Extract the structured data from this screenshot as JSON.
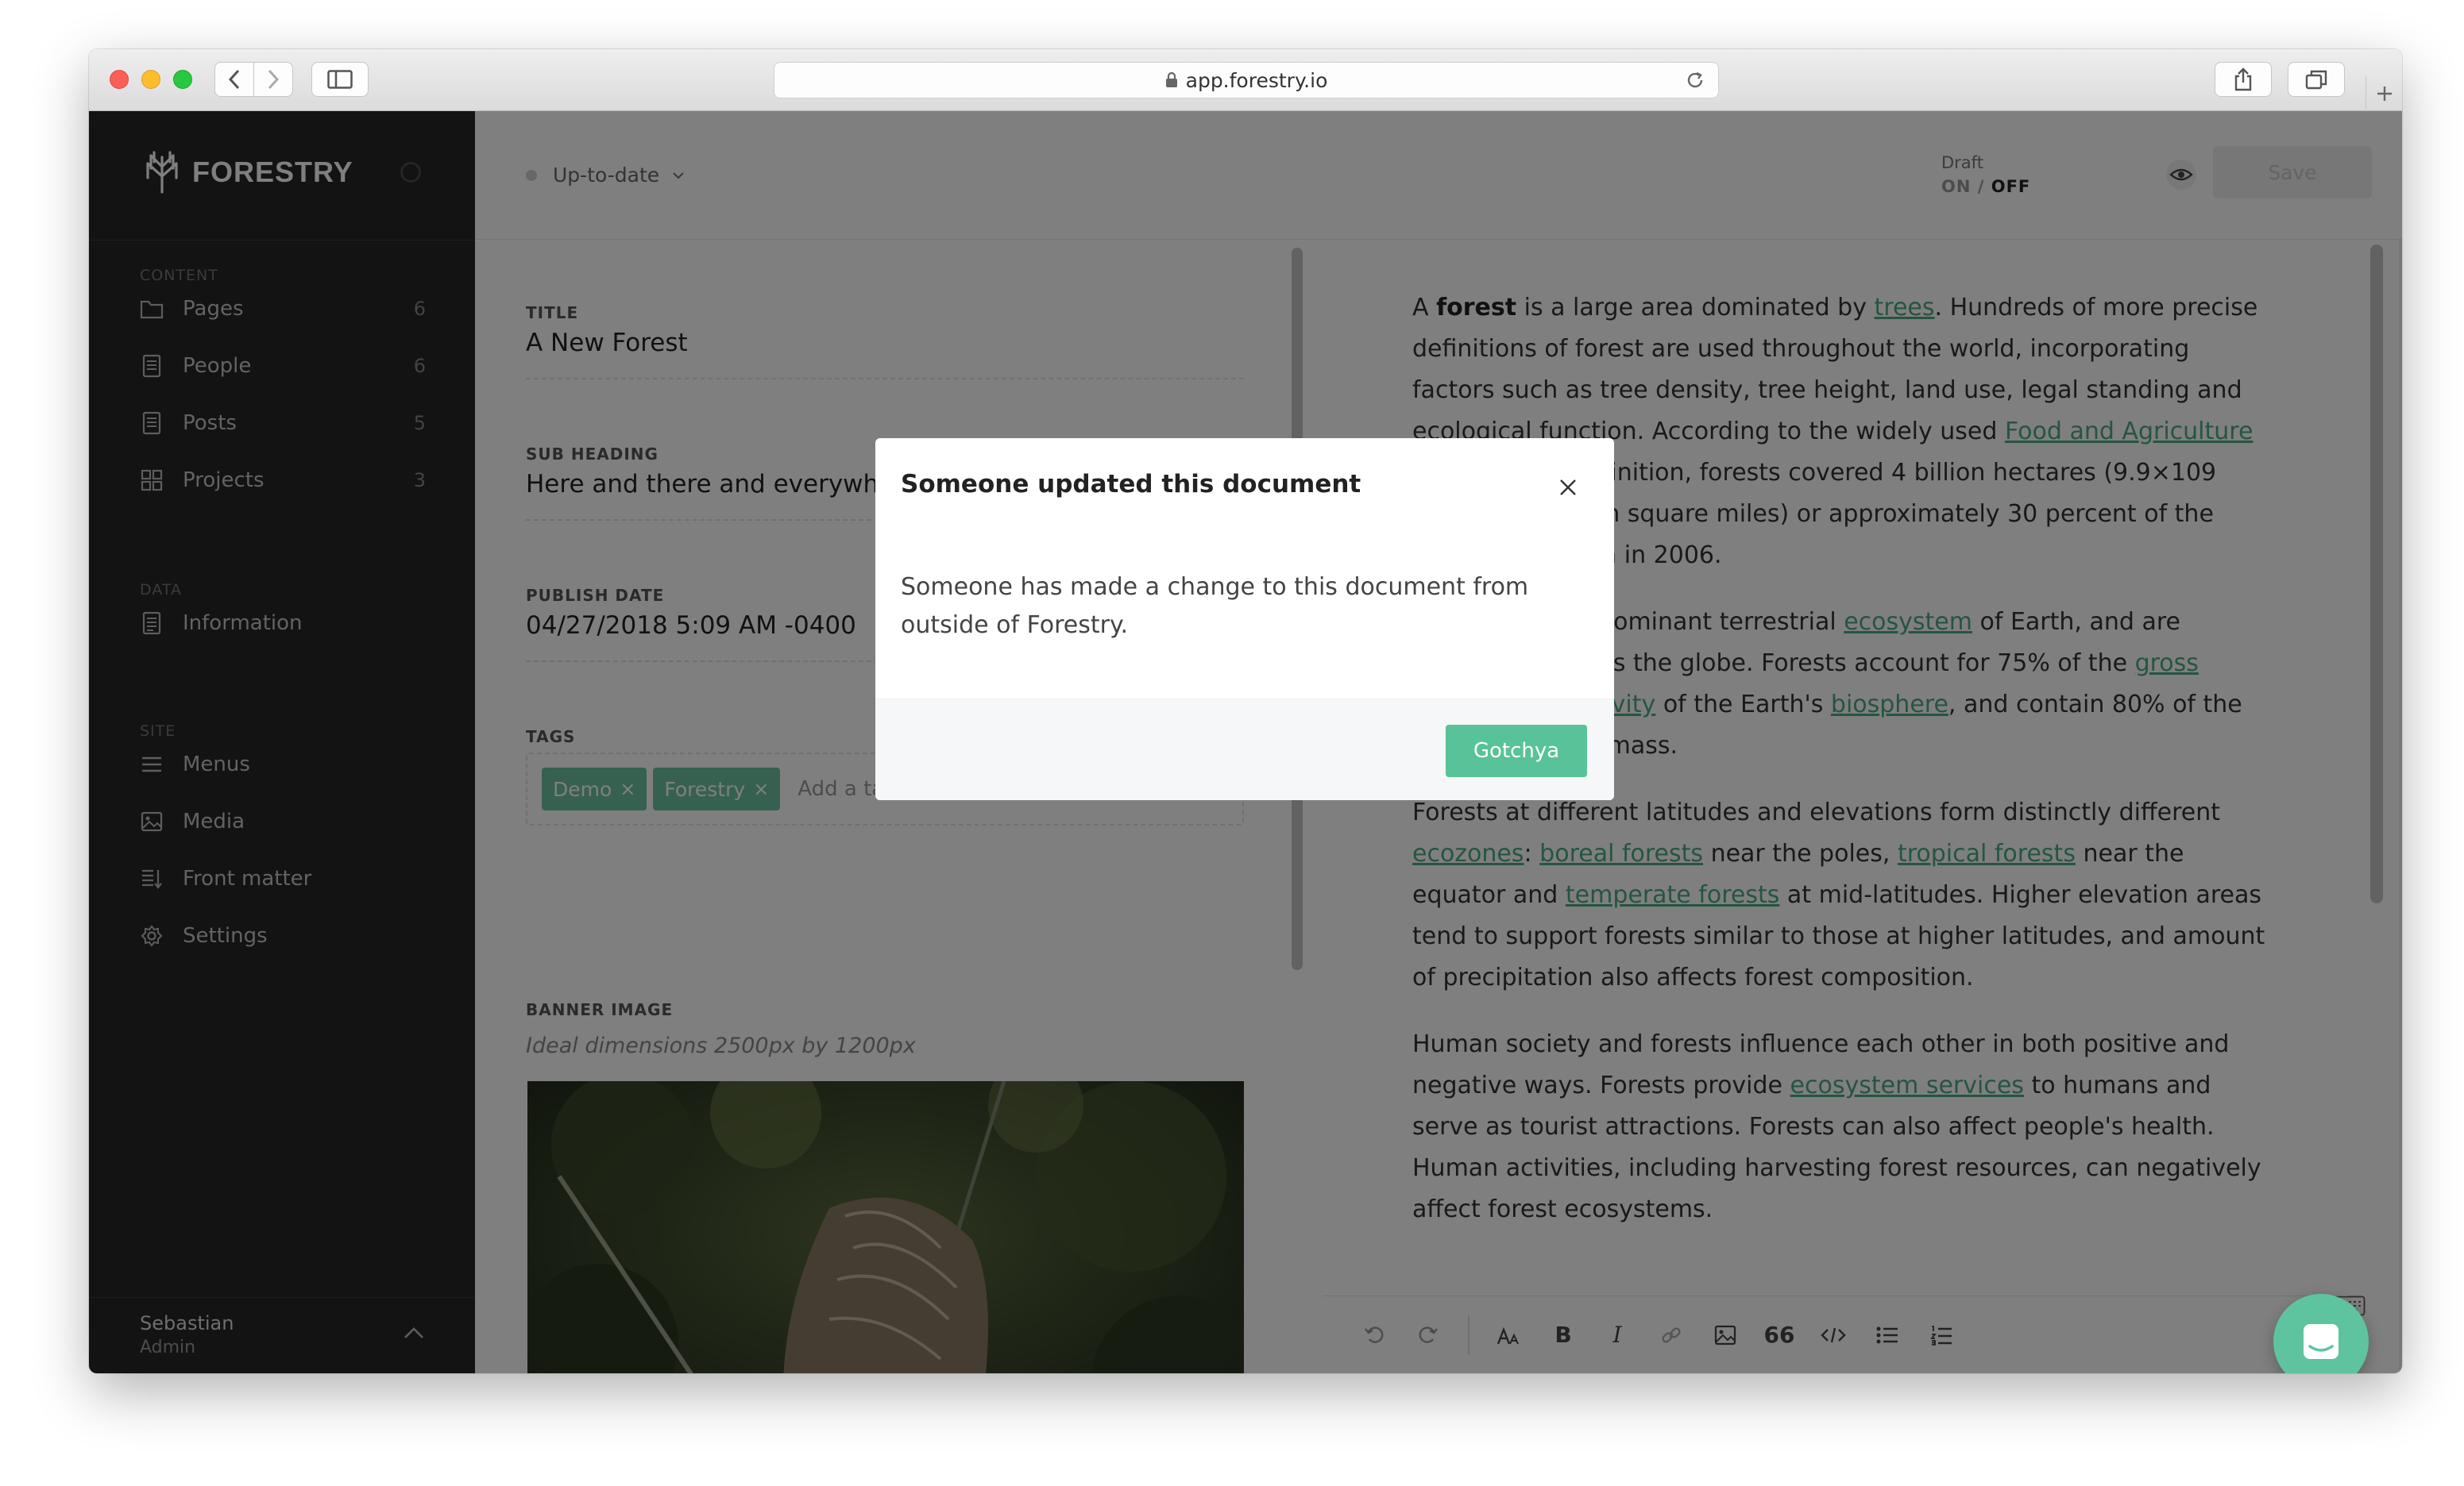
{
  "browser": {
    "url": "app.forestry.io"
  },
  "sidebar": {
    "logo_text": "FORESTRY",
    "sections": {
      "content": "CONTENT",
      "data": "DATA",
      "site": "SITE"
    },
    "content_items": [
      {
        "label": "Pages",
        "count": "6",
        "icon": "folder-icon"
      },
      {
        "label": "People",
        "count": "6",
        "icon": "document-icon"
      },
      {
        "label": "Posts",
        "count": "5",
        "icon": "document-icon"
      },
      {
        "label": "Projects",
        "count": "3",
        "icon": "grid-icon"
      }
    ],
    "data_items": [
      {
        "label": "Information",
        "icon": "data-file-icon"
      }
    ],
    "site_items": [
      {
        "label": "Menus",
        "icon": "menu-icon"
      },
      {
        "label": "Media",
        "icon": "image-icon"
      },
      {
        "label": "Front matter",
        "icon": "front-matter-icon"
      },
      {
        "label": "Settings",
        "icon": "gear-icon"
      }
    ],
    "user": {
      "name": "Sebastian",
      "role": "Admin"
    }
  },
  "topbar": {
    "status": "Up-to-date",
    "draft_label": "Draft",
    "draft_on": "ON",
    "draft_sep": "/",
    "draft_off": "OFF",
    "save_label": "Save"
  },
  "form": {
    "title_label": "TITLE",
    "title_value": "A New Forest",
    "subheading_label": "SUB HEADING",
    "subheading_value": "Here and there and everywhere",
    "publish_label": "PUBLISH DATE",
    "publish_value": "04/27/2018 5:09 AM -0400",
    "tags_label": "TAGS",
    "tags": [
      "Demo",
      "Forestry"
    ],
    "tag_remove": "×",
    "add_tag_placeholder": "Add a tag",
    "banner_label": "BANNER IMAGE",
    "banner_hint": "Ideal dimensions 2500px by 1200px"
  },
  "editor": {
    "p1": {
      "t1": "A ",
      "b1": "forest",
      "t2": " is a large area dominated by ",
      "l1": "trees",
      "t3": ". Hundreds of more precise definitions of forest are used throughout the world, incorporating factors such as tree density, tree height, land use, legal standing and ecological function. According to the widely used ",
      "l2": "Food and Agriculture Organization",
      "t4": " definition, forests covered 4 billion hectares (9.9×109 acres) (15 million square miles) or approximately 30 percent of the world's land area in 2006."
    },
    "p2": {
      "t1": "Forests are the dominant terrestrial ",
      "l1": "ecosystem",
      "t2": " of Earth, and are distributed across the globe. Forests account for 75% of the ",
      "l2": "gross primary productivity",
      "t3": " of the Earth's ",
      "l3": "biosphere",
      "t4": ", and contain 80% of the Earth's plant biomass."
    },
    "p3": {
      "t1": "Forests at different latitudes and elevations form distinctly different ",
      "l1": "ecozones",
      "t2": ": ",
      "l2": "boreal forests",
      "t3": " near the poles, ",
      "l3": "tropical forests",
      "t4": " near the equator and ",
      "l4": "temperate forests",
      "t5": " at mid-latitudes. Higher elevation areas tend to support forests similar to those at higher latitudes, and amount of precipitation also affects forest composition."
    },
    "p4": {
      "t1": "Human society and forests influence each other in both positive and negative ways. Forests provide ",
      "l1": "ecosystem services",
      "t2": " to humans and serve as tourist attractions. Forests can also affect people's health. Human activities, including harvesting forest resources, can negatively affect forest ecosystems."
    },
    "toolbar": {
      "undo_icon": "undo-icon",
      "redo_icon": "redo-icon",
      "heading_icon": "text-size-icon",
      "bold": "B",
      "italic": "I",
      "link_icon": "link-icon",
      "image_icon": "image-icon",
      "quote": "66",
      "code_icon": "code-icon",
      "bullet_list_icon": "bulleted-list-icon",
      "numbered_list_icon": "numbered-list-icon"
    }
  },
  "modal": {
    "title": "Someone updated this document",
    "body": "Someone has made a change to this document from outside of Forestry.",
    "button": "Gotchya"
  },
  "colors": {
    "accent": "#58c398",
    "sidebar_bg": "#262626",
    "link": "#4aaa83"
  }
}
